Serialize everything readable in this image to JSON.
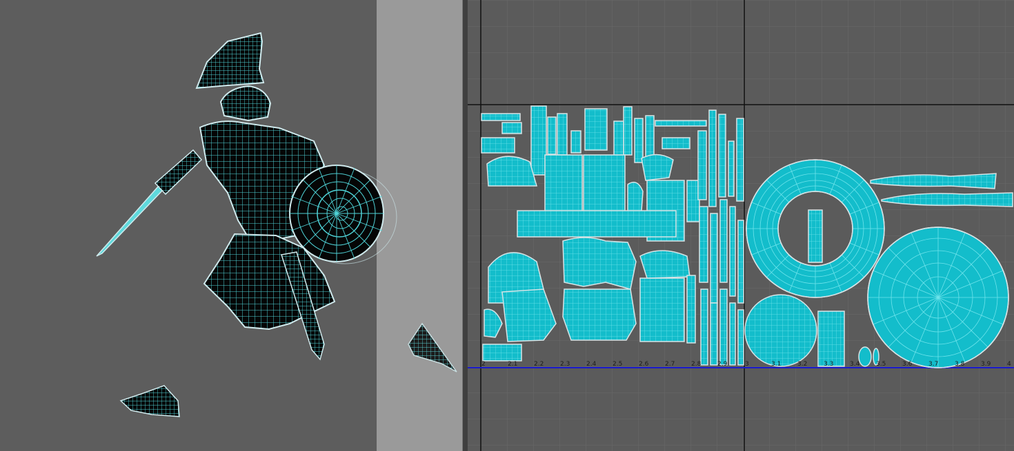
{
  "viewport": {
    "wire_color": "#54d8dc",
    "edge_color": "#cfe9ec",
    "fill_color": "#000000",
    "objects": [
      "gladiator-model",
      "floating-shell-fragment",
      "sandal-piece"
    ]
  },
  "uv_editor": {
    "tick_labels": [
      "2",
      "2.1",
      "2.2",
      "2.3",
      "2.4",
      "2.5",
      "2.6",
      "2.7",
      "2.8",
      "2.9",
      "3",
      "3.1",
      "3.2",
      "3.3",
      "3.4",
      "3.5",
      "3.6",
      "3.7",
      "3.8",
      "3.9",
      "4"
    ],
    "axis_color": "#1a1acc",
    "uv_color": "#1fc8d8",
    "uv_fill": "#0bb6c4"
  }
}
